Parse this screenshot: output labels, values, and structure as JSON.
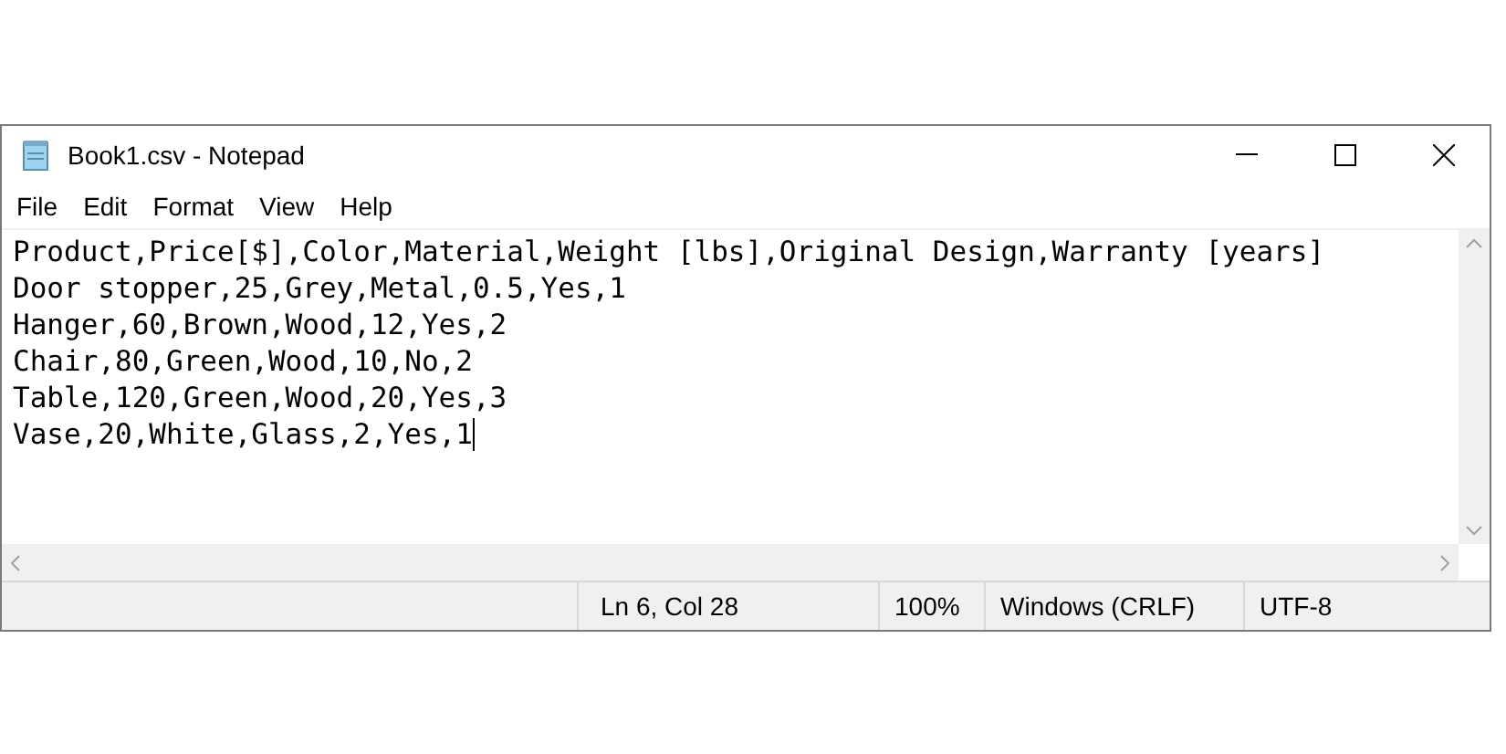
{
  "window": {
    "title": "Book1.csv - Notepad"
  },
  "menu": [
    "File",
    "Edit",
    "Format",
    "View",
    "Help"
  ],
  "editor": {
    "lines": [
      "Product,Price[$],Color,Material,Weight [lbs],Original Design,Warranty [years]",
      "Door stopper,25,Grey,Metal,0.5,Yes,1",
      "Hanger,60,Brown,Wood,12,Yes,2",
      "Chair,80,Green,Wood,10,No,2",
      "Table,120,Green,Wood,20,Yes,3",
      "Vase,20,White,Glass,2,Yes,1"
    ]
  },
  "status_bar": {
    "position": "Ln 6, Col 28",
    "zoom": "100%",
    "line_ending": "Windows (CRLF)",
    "encoding": "UTF-8"
  }
}
